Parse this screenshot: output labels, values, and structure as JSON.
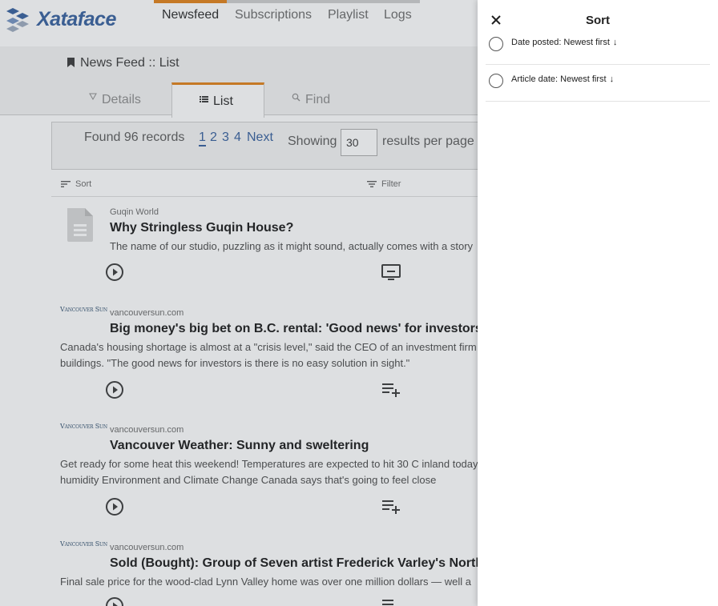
{
  "app": {
    "logo_text": "Xataface"
  },
  "topnav": {
    "items": [
      "Newsfeed",
      "Subscriptions",
      "Playlist",
      "Logs"
    ]
  },
  "page": {
    "title": "News Feed :: List"
  },
  "tabs": [
    "Details",
    "List",
    "Find"
  ],
  "results": {
    "found": "Found 96 records",
    "pages": [
      "1",
      "2",
      "3",
      "4"
    ],
    "next": "Next",
    "showing": "Showing",
    "per_page_value": "30",
    "per_page_suffix": "results per page"
  },
  "toolbar": {
    "sort": "Sort",
    "filter": "Filter"
  },
  "feed": [
    {
      "source": "Guqin World",
      "headline": "Why Stringless Guqin House?",
      "summary": "The name of our studio, puzzling as it might sound, actually comes with a story"
    },
    {
      "logo": "Vancouver Sun",
      "source": "vancouversun.com",
      "headline": "Big money's big bet on B.C. rental: 'Good news' for investors",
      "summary": "Canada's housing shortage is almost at a \"crisis level,\" said the CEO of an investment firm apartment buildings. \"The good news for investors is there is no easy solution in sight.\""
    },
    {
      "logo": "Vancouver Sun",
      "source": "vancouversun.com",
      "headline": "Vancouver Weather: Sunny and sweltering",
      "summary": "Get ready for some heat this weekend! Temperatures are expected to hit 30 C inland today with the humidity Environment and Climate Change Canada says that's going to feel close"
    },
    {
      "logo": "Vancouver Sun",
      "source": "vancouversun.com",
      "headline": "Sold (Bought): Group of Seven artist Frederick Varley's North",
      "summary": "Final sale price for the wood-clad Lynn Valley home was over one million dollars — well a"
    }
  ],
  "sort_panel": {
    "title": "Sort",
    "options": [
      {
        "label": "Date posted: Newest first",
        "arrow": "↓"
      },
      {
        "label": "Article date: Newest first",
        "arrow": "↓"
      }
    ]
  }
}
